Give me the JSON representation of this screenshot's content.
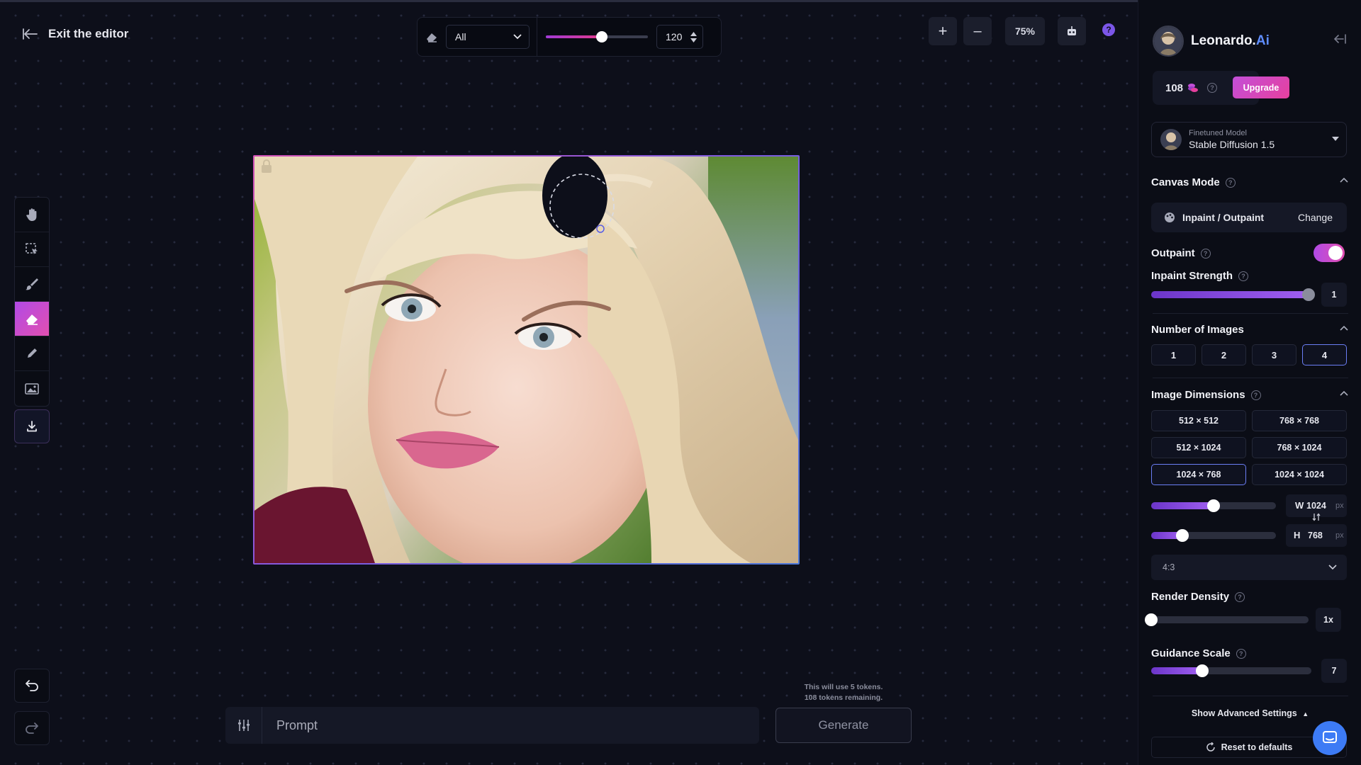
{
  "header": {
    "exit_label": "Exit the editor"
  },
  "toolbar": {
    "mode_selected": "All",
    "brush_size": "120",
    "brush_size_fraction": 0.55,
    "zoom_in": "+",
    "zoom_out": "–",
    "zoom_level": "75%"
  },
  "tools": [
    {
      "name": "hand-icon"
    },
    {
      "name": "select-icon"
    },
    {
      "name": "brush-icon"
    },
    {
      "name": "eraser-icon"
    },
    {
      "name": "pencil-icon"
    },
    {
      "name": "image-icon"
    }
  ],
  "prompt": {
    "placeholder": "Prompt",
    "tokens_line1": "This will use 5 tokens.",
    "tokens_line2": "108 tokens remaining.",
    "generate_label": "Generate"
  },
  "panel": {
    "brand_name": "Leonardo.",
    "brand_suffix": "Ai",
    "tokens": "108",
    "upgrade_label": "Upgrade",
    "model_caption": "Finetuned Model",
    "model_name": "Stable Diffusion 1.5",
    "canvas_mode_title": "Canvas Mode",
    "canvas_mode_value": "Inpaint / Outpaint",
    "change_label": "Change",
    "outpaint_label": "Outpaint",
    "outpaint_on": true,
    "inpaint_strength_label": "Inpaint Strength",
    "inpaint_strength_value": "1",
    "inpaint_strength_fraction": 1.0,
    "num_images_title": "Number of Images",
    "num_images_options": [
      "1",
      "2",
      "3",
      "4"
    ],
    "num_images_selected": "4",
    "dimensions_title": "Image Dimensions",
    "dimension_options": [
      "512 × 512",
      "768 × 768",
      "512 × 1024",
      "768 × 1024",
      "1024 × 768",
      "1024 × 1024"
    ],
    "dimension_selected": "1024 × 768",
    "width_label": "W",
    "width_value": "1024",
    "width_fraction": 0.5,
    "height_label": "H",
    "height_value": "768",
    "height_fraction": 0.25,
    "px_unit": "px",
    "aspect_ratio": "4:3",
    "render_density_title": "Render Density",
    "render_density_value": "1x",
    "render_density_fraction": 0.0,
    "guidance_title": "Guidance Scale",
    "guidance_value": "7",
    "guidance_fraction": 0.32,
    "advanced_label": "Show Advanced Settings",
    "reset_label": "Reset to defaults"
  },
  "colors": {
    "accent_pink": "#e24fb0",
    "accent_purple": "#a05ff0",
    "brand_blue": "#5f8dff"
  }
}
